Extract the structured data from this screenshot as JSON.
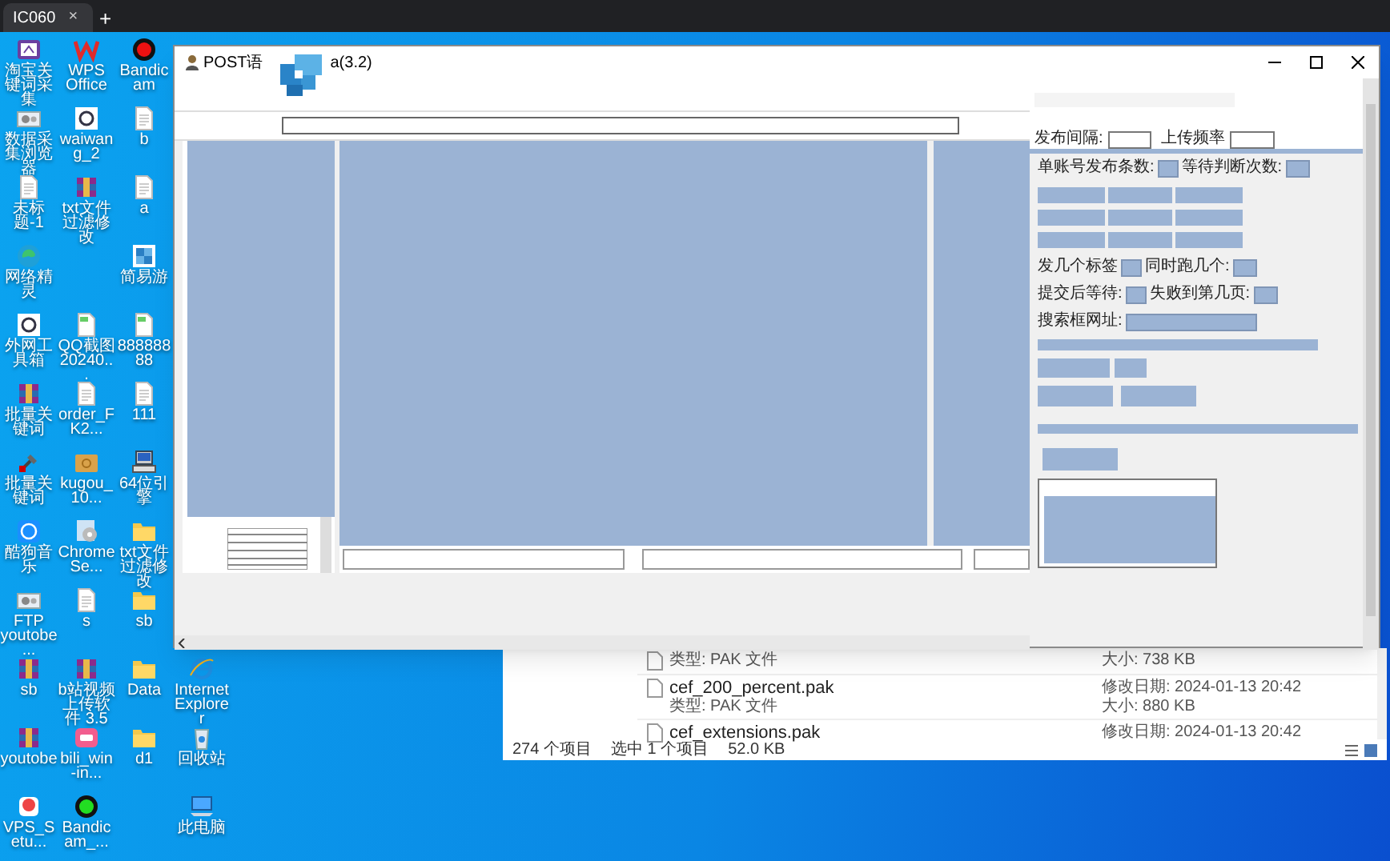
{
  "browser_tab": {
    "title": "IC060",
    "close": "×",
    "new_tab": "+"
  },
  "desktop_columns": [
    {
      "icons": [
        {
          "label": "淘宝关键词采集",
          "kind": "app"
        },
        {
          "label": "数据采集浏览器",
          "kind": "gear"
        },
        {
          "label": "未标题-1",
          "kind": "doc"
        },
        {
          "label": "网络精灵",
          "kind": "edge"
        },
        {
          "label": "外网工具箱",
          "kind": "clogo"
        },
        {
          "label": "批量关键词",
          "kind": "archive"
        },
        {
          "label": "批量关键词",
          "kind": "tools"
        },
        {
          "label": "酷狗音乐",
          "kind": "kapp"
        },
        {
          "label": "FTP youtobe...",
          "kind": "gear"
        },
        {
          "label": "sb",
          "kind": "archive"
        },
        {
          "label": "youtobe",
          "kind": "archive"
        },
        {
          "label": "VPS_Setu...",
          "kind": "redapp"
        }
      ]
    },
    {
      "icons": [
        {
          "label": "WPS Office",
          "kind": "wps"
        },
        {
          "label": "waiwang_2",
          "kind": "clogo"
        },
        {
          "label": "txt文件过滤修改",
          "kind": "archive"
        },
        {
          "label": "QQ截图20240...",
          "kind": "image"
        },
        {
          "label": "order_FK2...",
          "kind": "doc"
        },
        {
          "label": "kugou_10...",
          "kind": "box"
        },
        {
          "label": "ChromeSe...",
          "kind": "disc"
        },
        {
          "label": "s",
          "kind": "doc"
        },
        {
          "label": "b站视频上传软件 3.5",
          "kind": "archive"
        },
        {
          "label": "bili_win-in...",
          "kind": "pink"
        },
        {
          "label": "Bandicam_...",
          "kind": "recgreen"
        }
      ]
    },
    {
      "icons": [
        {
          "label": "Bandicam",
          "kind": "recred"
        },
        {
          "label": "b",
          "kind": "doc"
        },
        {
          "label": "a",
          "kind": "doc"
        },
        {
          "label": "简易游",
          "kind": "square"
        },
        {
          "label": "88888888",
          "kind": "image"
        },
        {
          "label": "111",
          "kind": "doc"
        },
        {
          "label": "64位引擎",
          "kind": "computer"
        },
        {
          "label": "txt文件过滤修改",
          "kind": "folder"
        },
        {
          "label": "sb",
          "kind": "folder"
        },
        {
          "label": "Data",
          "kind": "folder"
        },
        {
          "label": "d1",
          "kind": "folder"
        }
      ]
    },
    {
      "icons": [
        {
          "label": "Internet Explorer",
          "kind": "ie"
        },
        {
          "label": "回收站",
          "kind": "bin"
        },
        {
          "label": "此电脑",
          "kind": "pc"
        }
      ]
    }
  ],
  "window": {
    "title": "POST语",
    "title_suffix": "a(3.2)",
    "settings": {
      "top_labels": [
        "发布间隔:",
        "上传频率"
      ],
      "rows": [
        {
          "left": "单账号发布条数:",
          "right": "等待判断次数:"
        },
        {
          "left": "发几个标签",
          "right": "同时跑几个:"
        },
        {
          "left": "提交后等待:",
          "right": "失败到第几页:"
        }
      ],
      "url_label": "搜索框网址:"
    }
  },
  "explorer": {
    "rows": [
      {
        "type": "类型: PAK 文件",
        "size": "大小: 738 KB"
      },
      {
        "name": "cef_200_percent.pak",
        "type": "类型: PAK 文件",
        "modified": "修改日期: 2024-01-13 20:42",
        "size": "大小: 880 KB"
      },
      {
        "name": "cef_extensions.pak",
        "modified": "修改日期: 2024-01-13 20:42"
      }
    ],
    "status": [
      "274 个项目",
      "选中 1 个项目",
      "52.0 KB"
    ]
  }
}
